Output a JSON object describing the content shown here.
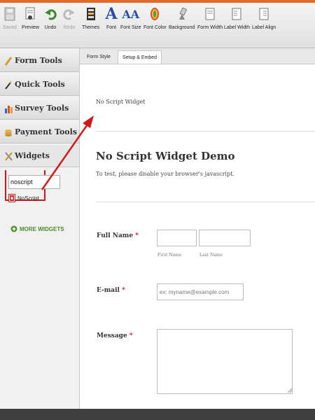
{
  "toolbar": {
    "items": [
      {
        "label": "Saved",
        "icon": "save-icon",
        "disabled": true
      },
      {
        "label": "Preview",
        "icon": "preview-icon",
        "disabled": false
      },
      {
        "label": "Undo",
        "icon": "undo-icon",
        "disabled": false
      },
      {
        "label": "Redo",
        "icon": "redo-icon",
        "disabled": true
      },
      {
        "label": "Themes",
        "icon": "themes-icon",
        "disabled": false
      },
      {
        "label": "Font",
        "icon": "font-icon",
        "disabled": false
      },
      {
        "label": "Font Size",
        "icon": "font-size-icon",
        "disabled": false
      },
      {
        "label": "Font Color",
        "icon": "font-color-icon",
        "disabled": false
      },
      {
        "label": "Background",
        "icon": "background-icon",
        "disabled": false
      },
      {
        "label": "Form Width",
        "icon": "form-width-icon",
        "disabled": false
      },
      {
        "label": "Label Width",
        "icon": "label-width-icon",
        "disabled": false
      },
      {
        "label": "Label Align",
        "icon": "label-align-icon",
        "disabled": false
      }
    ]
  },
  "sidebar": {
    "items": [
      {
        "label": "Form Tools",
        "icon": "pencil-icon"
      },
      {
        "label": "Quick Tools",
        "icon": "wand-icon"
      },
      {
        "label": "Survey Tools",
        "icon": "bar-chart-icon"
      },
      {
        "label": "Payment Tools",
        "icon": "coins-icon"
      },
      {
        "label": "Widgets",
        "icon": "tools-icon"
      }
    ],
    "widget_search_value": "noscript",
    "widget_result": "NoScript",
    "more_widgets": "MORE WIDGETS"
  },
  "tabs": [
    {
      "label": "Form Style",
      "active": false
    },
    {
      "label": "Setup & Embed",
      "active": true
    }
  ],
  "form": {
    "widget_text": "No Script Widget",
    "heading": "No Script Widget Demo",
    "subheading": "To test, please disable your browser's javascript.",
    "fields": {
      "full_name_label": "Full Name",
      "first_name_sub": "First Name",
      "last_name_sub": "Last Name",
      "email_label": "E-mail",
      "email_placeholder": "ex: myname@example.com",
      "message_label": "Message",
      "required_mark": "*"
    }
  },
  "colors": {
    "accent": "#e06a2a",
    "highlight": "#d11919",
    "green": "#4a8a2a"
  }
}
